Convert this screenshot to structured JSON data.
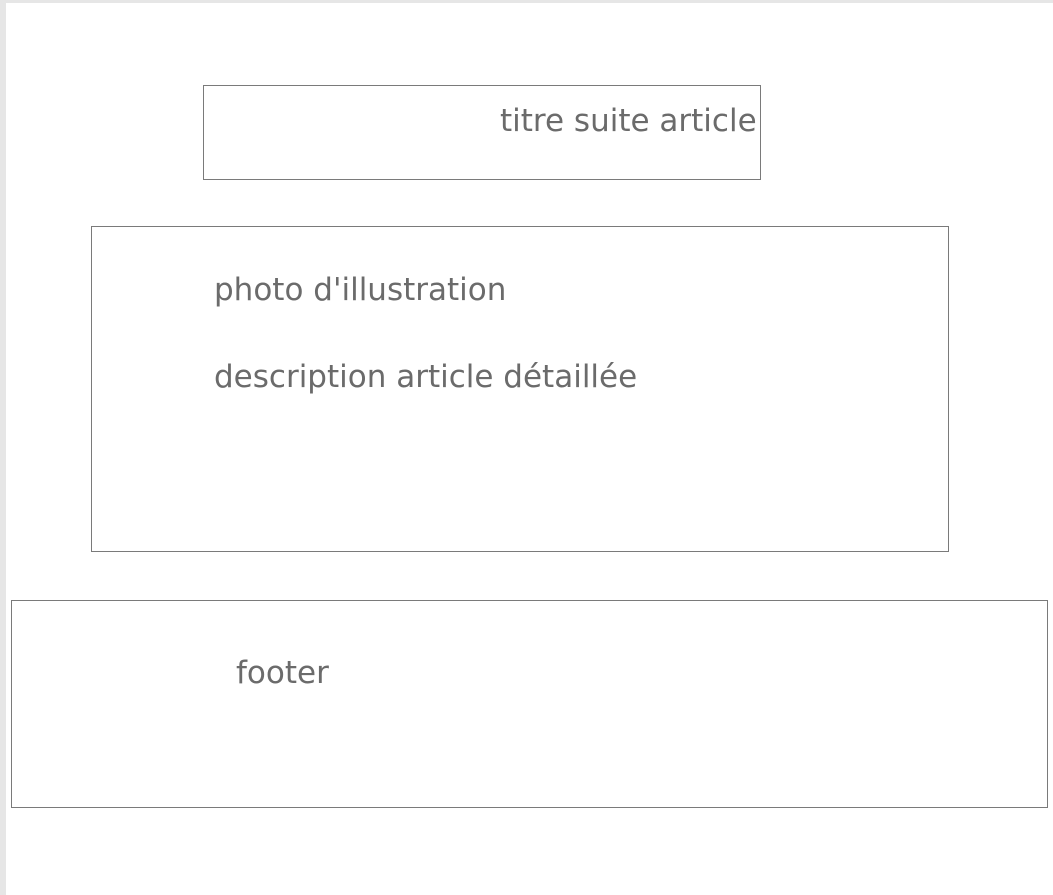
{
  "title_block": {
    "label": "titre suite article"
  },
  "content_block": {
    "photo_label": "photo d'illustration",
    "description_label": "description article détaillée"
  },
  "footer_block": {
    "label": "footer"
  },
  "colors": {
    "border": "#7a7a7a",
    "text": "#6b6b6b",
    "background": "#ffffff",
    "frame": "#e6e6e6"
  }
}
